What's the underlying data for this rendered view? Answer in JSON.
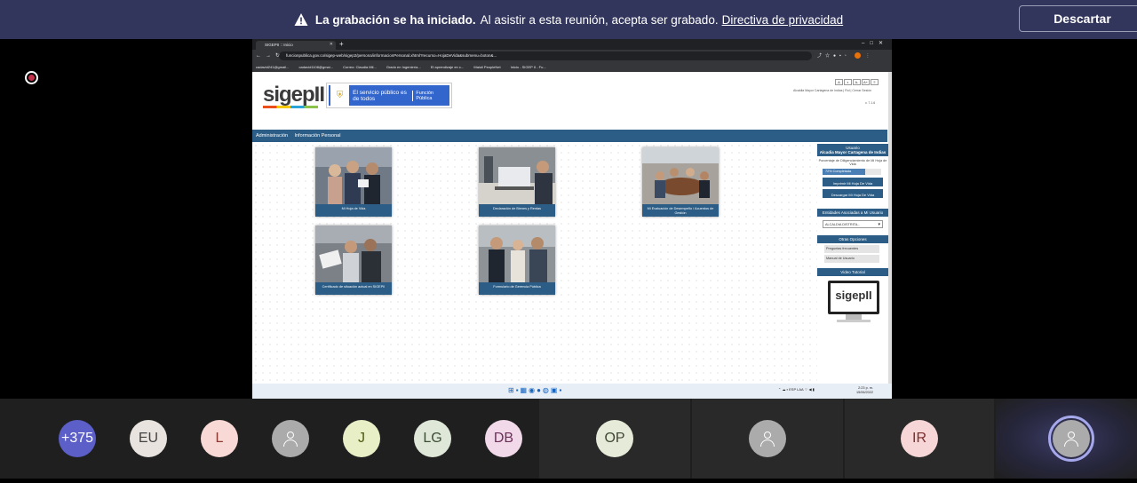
{
  "banner": {
    "title": "La grabación se ha iniciado.",
    "message": "Al asistir a esta reunión, acepta ser grabado.",
    "link": "Directiva de privacidad",
    "dismiss_label": "Descartar",
    "bg_color": "#33365c"
  },
  "browser": {
    "tab_title": "SIGEPII :: Inicio",
    "url": "funcionpublica.gov.co/sigep-web/sigep2/persona/informacionPersonal.xhtml?recurso=HojaDeVida&submenu=boton&...",
    "bookmarks": [
      "cadavid241@gmail...",
      "cadavid1108@gmai...",
      "Correo: Claudia Mil...",
      "Grado en Ingeniería...",
      "El aprendizaje en c...",
      "Maluli PeopleNet",
      "Inicio - SIGEP II - Fu..."
    ]
  },
  "site": {
    "logo": "sigepII",
    "gov_text": "El servicio público es de todos",
    "gov_sub": "Función Pública",
    "user_line": "Alcaldia Mayor Cartagena de Indias | Rol | Cerrar Sesión",
    "version": "v. 7.1.6",
    "menu": [
      "Administración",
      "Información Personal"
    ],
    "brand_color": "#2b5d86"
  },
  "cards": [
    {
      "label": "Mi Hoja de Vida"
    },
    {
      "label": "Declaración de Bienes y Rentas"
    },
    {
      "label": "Mi Evaluación de Desempeño / Acuerdos de Gestión"
    },
    {
      "label": "Certificado de situación actual en SIGEPII"
    },
    {
      "label": "Formulario de Gerencia Pública"
    }
  ],
  "sidebar": {
    "user_header": "Usuario",
    "user_name": "Alcadia Mayor Cartagena de Indias",
    "progress_label": "Porcentaje de Diligenciamiento de Mi Hoja de Vida",
    "progress_value": 72,
    "progress_text": "72% Completada",
    "print_button": "Imprimir Mi Hoja De Vida",
    "download_button": "Descargar Mi Hoja De Vida",
    "entities_header": "Entidades Asociadas a Mi Usuario",
    "entity_selected": "ALCALDIA DISTRITA...",
    "other_header": "Otras Opciones",
    "links": [
      "Preguntas frecuentes",
      "Manual de Usuario"
    ],
    "video_header": "Video Tutorial",
    "video_logo": "sigepII"
  },
  "taskbar": {
    "lang": "ESP LAA",
    "time": "2:23 p. m.",
    "date": "15/06/2022"
  },
  "participants": [
    {
      "initials": "+375",
      "bg": "#5b5fc7",
      "fg": "#ffffff"
    },
    {
      "initials": "EU",
      "bg": "#e8e3df",
      "fg": "#444444"
    },
    {
      "initials": "L",
      "bg": "#f9d9d5",
      "fg": "#8b3a32"
    },
    {
      "initials": "",
      "bg": "#ababab",
      "fg": "#ffffff"
    },
    {
      "initials": "J",
      "bg": "#e8efc7",
      "fg": "#4f5a12"
    },
    {
      "initials": "LG",
      "bg": "#dfe8d8",
      "fg": "#3d4d34"
    },
    {
      "initials": "DB",
      "bg": "#f2d9ea",
      "fg": "#6b2f58"
    },
    {
      "initials": "OP",
      "bg": "#e6ebd9",
      "fg": "#3e4731"
    },
    {
      "initials": "",
      "bg": "#ababab",
      "fg": "#ffffff"
    },
    {
      "initials": "IR",
      "bg": "#f6d6d6",
      "fg": "#7a2e2e"
    },
    {
      "initials": "",
      "bg": "#ababab",
      "fg": "#ffffff"
    }
  ]
}
